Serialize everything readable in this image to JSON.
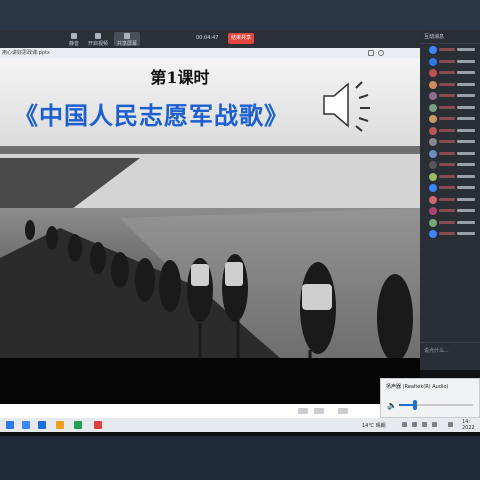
{
  "meeting_toolbar": {
    "buttons": [
      "静音",
      "开启视频",
      "共享屏幕"
    ],
    "timer": "00:04:47",
    "record_label": "结束共享"
  },
  "slide_window": {
    "filename": "用心讲好思政课.pptx"
  },
  "slide": {
    "lesson": "第1课时",
    "title": "《中国人民志愿军战歌》",
    "speaker_icon": "speaker-icon"
  },
  "sidebar": {
    "header": "互动消息",
    "input_placeholder": "说点什么..."
  },
  "volume_flyout": {
    "device": "扬声器 (Realtek(R) Audio)",
    "level": 0.22
  },
  "taskbar": {
    "weather": "14℃ 晴朗",
    "time": "14:",
    "date": "2022"
  },
  "colors": {
    "title_blue": "#1b5fd1",
    "record_red": "#e2483d",
    "accent": "#1f6fd0"
  }
}
